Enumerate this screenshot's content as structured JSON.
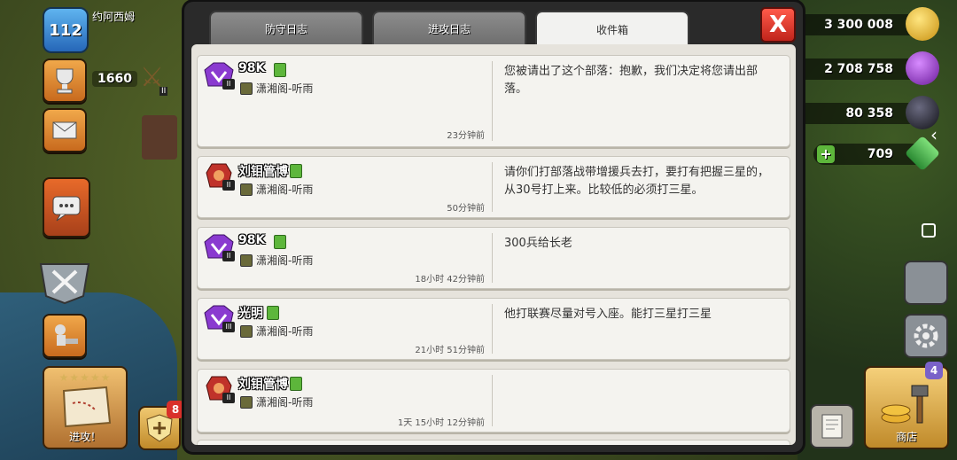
{
  "player": {
    "level": "112",
    "name": "约阿西姆",
    "trophies": "1660",
    "league_tier": "II"
  },
  "resources": {
    "gold": "3 300 008",
    "elixir": "2 708 758",
    "dark_elixir": "80 358",
    "gems": "709"
  },
  "tabs": [
    {
      "label": "防守日志",
      "active": false
    },
    {
      "label": "进攻日志",
      "active": false
    },
    {
      "label": "收件箱",
      "active": true
    }
  ],
  "close_label": "X",
  "messages": [
    {
      "sender": "98K",
      "tier": "II",
      "clan": "潇湘阁-听雨",
      "time": "23分钟前",
      "text": "您被请出了这个部落：抱歉，我们决定将您请出部落。"
    },
    {
      "sender": "刘钼管博",
      "tier": "II",
      "clan": "潇湘阁-听雨",
      "time": "50分钟前",
      "text": "请你们打部落战带增援兵去打，要打有把握三星的，从30号打上来。比较低的必须打三星。"
    },
    {
      "sender": "98K",
      "tier": "II",
      "clan": "潇湘阁-听雨",
      "time": "18小时 42分钟前",
      "text": "300兵给长老"
    },
    {
      "sender": "光明",
      "tier": "III",
      "clan": "潇湘阁-听雨",
      "time": "21小时 51分钟前",
      "text": "他打联赛尽量对号入座。能打三星打三星"
    },
    {
      "sender": "刘钼管博",
      "tier": "II",
      "clan": "潇湘阁-听雨",
      "time": "1天 15小时 12分钟前",
      "text": ""
    }
  ],
  "attack_label": "进攻！",
  "shop_label": "商店",
  "shop_badge": "4",
  "shield_badge": "8",
  "colors": {
    "gold": "#f2c230",
    "elixir": "#8b2fb8",
    "dark_elixir": "#2a2a3a",
    "gem": "#3fa84a"
  }
}
